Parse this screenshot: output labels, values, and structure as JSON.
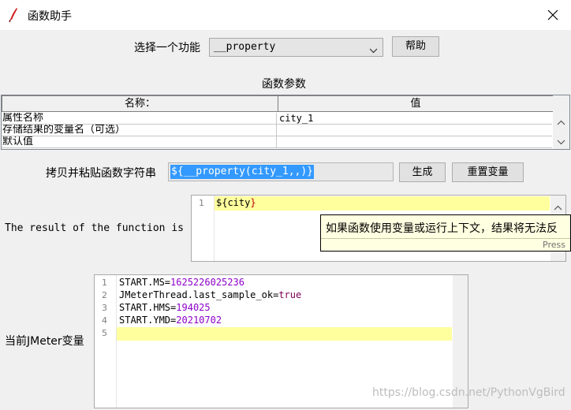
{
  "window": {
    "title": "函数助手"
  },
  "selector": {
    "label": "选择一个功能",
    "value": "__property",
    "help_label": "帮助"
  },
  "params": {
    "section_title": "函数参数",
    "columns": [
      "名称：",
      "值"
    ],
    "rows": [
      {
        "name": "属性名称",
        "value": "city_1"
      },
      {
        "name": "存储结果的变量名（可选）",
        "value": ""
      },
      {
        "name": "默认值",
        "value": ""
      }
    ]
  },
  "copy": {
    "label": "拷贝并粘贴函数字符串",
    "value": "${__property(city_1,,)}",
    "generate_label": "生成",
    "reset_label": "重置变量"
  },
  "result": {
    "label": "The result of the function is",
    "line_number": "1",
    "text_prefix": "${",
    "text_body": "city",
    "text_suffix": "}"
  },
  "tooltip": {
    "text": "如果函数使用变量或运行上下文，结果将无法反",
    "footer": "Press"
  },
  "variables": {
    "label": "当前JMeter变量",
    "line_numbers": [
      "1",
      "2",
      "3",
      "4",
      "5"
    ],
    "lines": [
      {
        "key": "START.MS",
        "value": "1625226025236"
      },
      {
        "key": "JMeterThread.last_sample_ok",
        "value": "true"
      },
      {
        "key": "START.HMS",
        "value": "194025"
      },
      {
        "key": "START.YMD",
        "value": "20210702"
      }
    ]
  },
  "watermark": "https://blog.csdn.net/PythonVgBird",
  "colors": {
    "selection": "#3399ff",
    "current_line": "#ffff9e",
    "number": "#8b00c8",
    "keyword": "#7f0055"
  }
}
